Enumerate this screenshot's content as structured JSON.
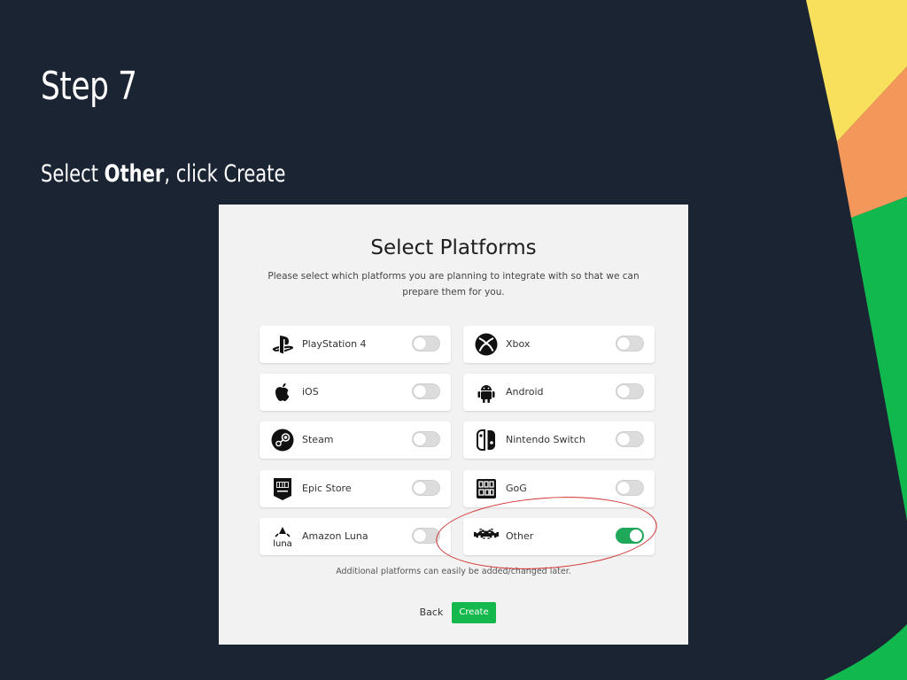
{
  "slide": {
    "title": "Step 7",
    "instruction_prefix": "Select ",
    "instruction_bold": "Other",
    "instruction_suffix": ", click Create",
    "colors": {
      "background": "#1b2433",
      "yellow": "#f8e05c",
      "orange": "#f4975a",
      "green": "#11b84e"
    }
  },
  "dialog": {
    "title": "Select Platforms",
    "description": "Please select which platforms you are planning to integrate with so that we can prepare them for you.",
    "platforms": [
      {
        "label": "PlayStation 4",
        "icon": "playstation-icon",
        "enabled": false
      },
      {
        "label": "Xbox",
        "icon": "xbox-icon",
        "enabled": false
      },
      {
        "label": "iOS",
        "icon": "apple-icon",
        "enabled": false
      },
      {
        "label": "Android",
        "icon": "android-icon",
        "enabled": false
      },
      {
        "label": "Steam",
        "icon": "steam-icon",
        "enabled": false
      },
      {
        "label": "Nintendo Switch",
        "icon": "nintendo-switch-icon",
        "enabled": false
      },
      {
        "label": "Epic Store",
        "icon": "epic-games-icon",
        "enabled": false
      },
      {
        "label": "GoG",
        "icon": "gog-icon",
        "enabled": false
      },
      {
        "label": "Amazon Luna",
        "icon": "amazon-luna-icon",
        "enabled": false
      },
      {
        "label": "Other",
        "icon": "space-invader-icon",
        "enabled": true
      }
    ],
    "footnote": "Additional platforms can easily be added/changed later.",
    "back_label": "Back",
    "create_label": "Create",
    "toggle_on_color": "#1fa85a",
    "create_color": "#14b84d"
  }
}
